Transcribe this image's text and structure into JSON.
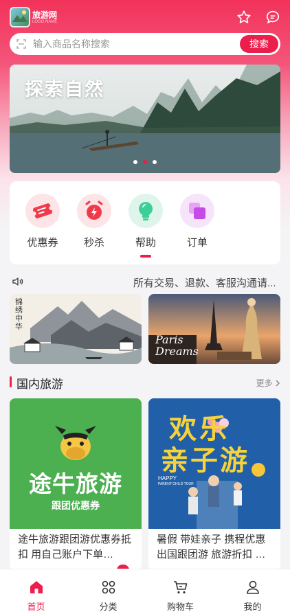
{
  "app": {
    "logo_text": "旅游网",
    "logo_sub": "LOGO NAME"
  },
  "header": {
    "favorite_icon": "star-icon",
    "chat_icon": "chat-icon"
  },
  "search": {
    "placeholder": "输入商品名称搜索",
    "button_label": "搜索",
    "scan_icon": "scan-icon"
  },
  "banner": {
    "title": "探索自然",
    "active_index": 1,
    "count": 3
  },
  "categories": [
    {
      "label": "优惠券",
      "icon": "ticket-icon",
      "color": "#fde4e6"
    },
    {
      "label": "秒杀",
      "icon": "flash-sale-icon",
      "color": "#fde4e6"
    },
    {
      "label": "帮助",
      "icon": "lightbulb-icon",
      "color": "#dff5ec"
    },
    {
      "label": "订单",
      "icon": "order-icon",
      "color": "#f6e4fb"
    }
  ],
  "notice": {
    "icon": "speaker-icon",
    "text": "所有交易、退款、客服沟通请..."
  },
  "promos": [
    {
      "caption": "锦绣中华",
      "name": "china-landscape-promo"
    },
    {
      "caption": "Paris Dreams",
      "name": "paris-promo"
    }
  ],
  "section": {
    "title": "国内旅游",
    "more_label": "更多",
    "more_icon": "chevron-right-icon"
  },
  "products": [
    {
      "brand": "途牛旅游",
      "tag": "跟团优惠券",
      "desc": "途牛旅游跟团游优惠券抵扣 用自己账户下单…"
    },
    {
      "headline_1": "欢乐",
      "headline_2": "亲子游",
      "sub": "HAPPY",
      "sub2": "PARENT-CHILD TOUR",
      "desc": "暑假 带娃亲子 携程优惠 出国跟团游 旅游折扣 …"
    }
  ],
  "tabbar": [
    {
      "label": "首页",
      "icon": "home-icon",
      "active": true
    },
    {
      "label": "分类",
      "icon": "category-icon",
      "active": false
    },
    {
      "label": "购物车",
      "icon": "cart-icon",
      "active": false
    },
    {
      "label": "我的",
      "icon": "user-icon",
      "active": false
    }
  ],
  "colors": {
    "accent": "#ec1f4c",
    "header_top": "#f2325a"
  }
}
